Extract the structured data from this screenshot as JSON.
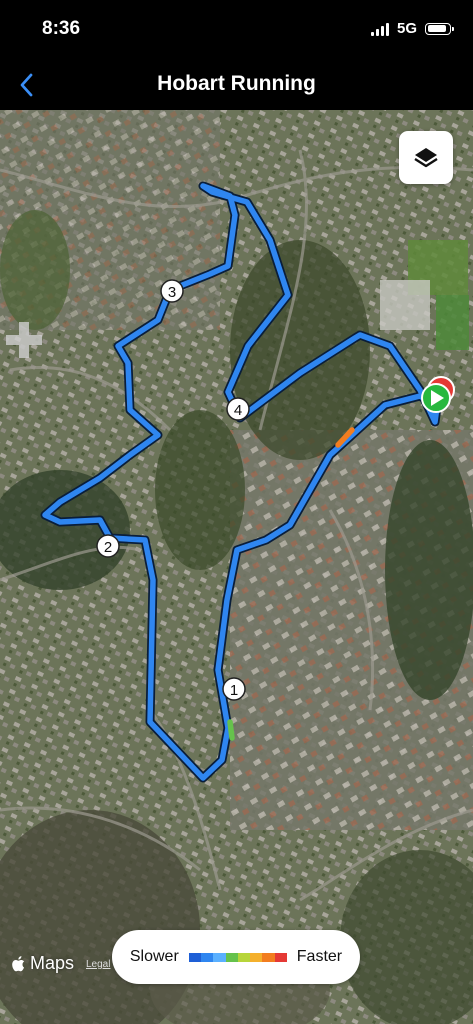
{
  "status_bar": {
    "time": "8:36",
    "network": "5G",
    "battery_level": 0.9
  },
  "nav": {
    "title": "Hobart Running"
  },
  "map": {
    "attribution": "Maps",
    "legal_link": "Legal",
    "split_markers": [
      "1",
      "2",
      "3",
      "4"
    ],
    "route_color": "#2f86f0",
    "start_color": "#27b83e",
    "end_color": "#e53935"
  },
  "legend": {
    "slower_label": "Slower",
    "faster_label": "Faster",
    "colors": [
      "#1e5fd6",
      "#2f86f0",
      "#5ab0ff",
      "#66c24c",
      "#b7d53a",
      "#f4b02c",
      "#f27d1f",
      "#e53935"
    ]
  }
}
